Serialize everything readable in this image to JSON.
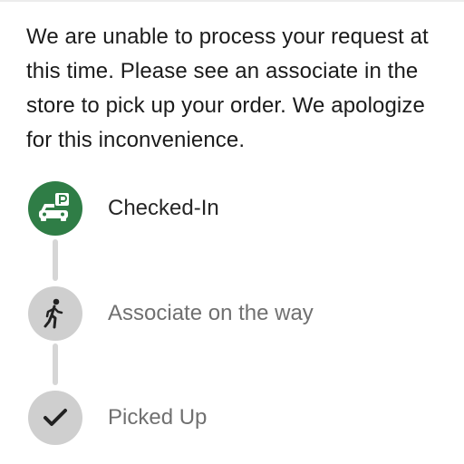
{
  "message": "We are unable to process your request at this time. Please see an associate in the store to pick up your order. We apologize for this inconvenience.",
  "colors": {
    "active": "#2f7d46",
    "inactive": "#cfcfcf",
    "connector": "#d6d6d6",
    "text_active": "#262626",
    "text_inactive": "#707070"
  },
  "steps": [
    {
      "label": "Checked-In",
      "icon": "car-parking-icon",
      "state": "active"
    },
    {
      "label": "Associate on the way",
      "icon": "walking-person-icon",
      "state": "inactive"
    },
    {
      "label": "Picked Up",
      "icon": "checkmark-icon",
      "state": "inactive"
    }
  ]
}
